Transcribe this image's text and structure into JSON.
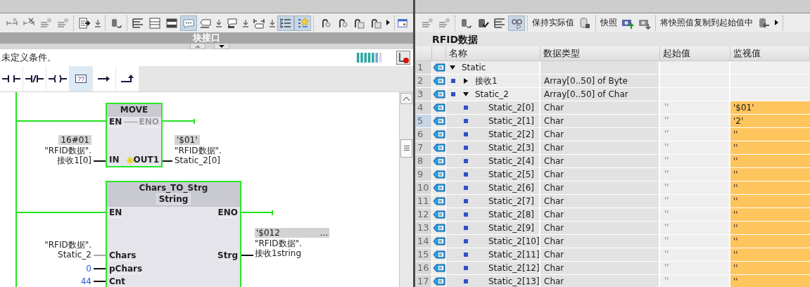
{
  "left_toolbar": {
    "groups": [
      {
        "items": [
          {
            "selected": false
          },
          {
            "selected": false
          },
          {
            "selected": false
          },
          {
            "selected": false
          }
        ]
      },
      {
        "items": [
          {
            "selected": false
          },
          {
            "selected": false
          }
        ]
      },
      {
        "items": [
          {
            "selected": false
          }
        ]
      },
      {
        "items": [
          {
            "selected": false
          },
          {
            "selected": false
          },
          {
            "selected": false
          },
          {
            "selected": true
          },
          {
            "selected": false
          },
          {
            "selected": false
          },
          {
            "selected": false
          },
          {
            "selected": false
          },
          {
            "selected": false
          },
          {
            "selected": false
          },
          {
            "selected": true
          },
          {
            "selected": true
          }
        ]
      },
      {
        "items": [
          {
            "selected": false
          },
          {
            "selected": false
          },
          {
            "selected": false
          },
          {
            "selected": false
          },
          {
            "selected": false
          }
        ]
      }
    ]
  },
  "interface_bar": {
    "title": "块接口"
  },
  "status": {
    "message": "未定义条件。"
  },
  "instruction_palette": [
    {
      "selected": false
    },
    {
      "selected": false
    },
    {
      "selected": false
    },
    {
      "label": "??",
      "selected": true
    },
    {
      "selected": false
    },
    {
      "selected": false
    }
  ],
  "move_block": {
    "title": "MOVE",
    "en_pin": "EN",
    "eno_pin": {
      "label": "ENO",
      "disabled": true
    },
    "in_pin": "IN",
    "out_pin": "OUT1",
    "in_value": "16#01",
    "in_operand": [
      "\"RFID数据\".",
      "接收1[0]"
    ],
    "out_value": "'$01'",
    "out_operand": [
      "\"RFID数据\".",
      "Static_2[0]"
    ]
  },
  "convert_block": {
    "title": "Chars_TO_Strg",
    "type": "String",
    "en_pin": "EN",
    "eno_pin": "ENO",
    "inputs": [
      {
        "pin": "Chars",
        "operand": [
          "\"RFID数据\".",
          "Static_2"
        ],
        "kind": "tag",
        "active": false
      },
      {
        "pin": "pChars",
        "operand": [
          "0"
        ],
        "kind": "constant",
        "active": true
      },
      {
        "pin": "Cnt",
        "operand": [
          "44"
        ],
        "kind": "constant",
        "active": true
      }
    ],
    "output": {
      "pin": "Strg",
      "value": "'$012",
      "value_more": "...",
      "operand": [
        "\"RFID数据\".",
        "接收1string"
      ]
    }
  },
  "right_toolbar": {
    "groups": [
      {
        "items": [
          {
            "selected": false
          },
          {
            "selected": false
          }
        ]
      },
      {
        "items": [
          {
            "selected": false
          },
          {
            "selected": false
          },
          {
            "selected": false
          },
          {
            "selected": true
          }
        ]
      },
      {
        "items": [
          {
            "label": "保持实际值",
            "selected": false
          },
          {
            "selected": false
          }
        ]
      },
      {
        "items": [
          {
            "label": "快照",
            "selected": false
          },
          {
            "selected": false
          },
          {
            "selected": false
          }
        ]
      },
      {
        "items": [
          {
            "label": "将快照值复制到起始值中",
            "selected": false
          },
          {
            "selected": false
          },
          {
            "selected": false
          }
        ]
      }
    ]
  },
  "table": {
    "title": "RFID数据",
    "columns": [
      "名称",
      "数据类型",
      "起始值",
      "监视值"
    ],
    "rows": [
      {
        "number": "1",
        "name": "Static",
        "expanded": true,
        "selected": false,
        "highlighted": false,
        "children": [
          {
            "number": "2",
            "name": "接收1",
            "expanded": false,
            "data_type": "Array[0..50] of Byte",
            "selected": false,
            "highlighted": false
          },
          {
            "number": "3",
            "name": "Static_2",
            "expanded": true,
            "data_type": "Array[0..50] of Char",
            "selected": false,
            "highlighted": false,
            "children": [
              {
                "number": "4",
                "name": "Static_2[0]",
                "data_type": "Char",
                "start_value": "''",
                "monitor_value": "'$01'",
                "selected": false,
                "highlighted": true
              },
              {
                "number": "5",
                "name": "Static_2[1]",
                "data_type": "Char",
                "start_value": "''",
                "monitor_value": "'2'",
                "selected": true,
                "highlighted": true
              },
              {
                "number": "6",
                "name": "Static_2[2]",
                "data_type": "Char",
                "start_value": "''",
                "monitor_value": "''",
                "selected": false,
                "highlighted": true
              },
              {
                "number": "7",
                "name": "Static_2[3]",
                "data_type": "Char",
                "start_value": "''",
                "monitor_value": "''",
                "selected": false,
                "highlighted": true
              },
              {
                "number": "8",
                "name": "Static_2[4]",
                "data_type": "Char",
                "start_value": "''",
                "monitor_value": "''",
                "selected": false,
                "highlighted": true
              },
              {
                "number": "9",
                "name": "Static_2[5]",
                "data_type": "Char",
                "start_value": "''",
                "monitor_value": "''",
                "selected": false,
                "highlighted": true
              },
              {
                "number": "10",
                "name": "Static_2[6]",
                "data_type": "Char",
                "start_value": "''",
                "monitor_value": "''",
                "selected": false,
                "highlighted": true
              },
              {
                "number": "11",
                "name": "Static_2[7]",
                "data_type": "Char",
                "start_value": "''",
                "monitor_value": "''",
                "selected": false,
                "highlighted": true
              },
              {
                "number": "12",
                "name": "Static_2[8]",
                "data_type": "Char",
                "start_value": "''",
                "monitor_value": "''",
                "selected": false,
                "highlighted": true
              },
              {
                "number": "13",
                "name": "Static_2[9]",
                "data_type": "Char",
                "start_value": "''",
                "monitor_value": "''",
                "selected": false,
                "highlighted": true
              },
              {
                "number": "14",
                "name": "Static_2[10]",
                "data_type": "Char",
                "start_value": "''",
                "monitor_value": "''",
                "selected": false,
                "highlighted": true
              },
              {
                "number": "15",
                "name": "Static_2[11]",
                "data_type": "Char",
                "start_value": "''",
                "monitor_value": "''",
                "selected": false,
                "highlighted": true
              },
              {
                "number": "16",
                "name": "Static_2[12]",
                "data_type": "Char",
                "start_value": "''",
                "monitor_value": "''",
                "selected": false,
                "highlighted": true
              },
              {
                "number": "17",
                "name": "Static_2[13]",
                "data_type": "Char",
                "start_value": "''",
                "monitor_value": "''",
                "selected": false,
                "highlighted": true
              }
            ]
          }
        ]
      }
    ]
  }
}
